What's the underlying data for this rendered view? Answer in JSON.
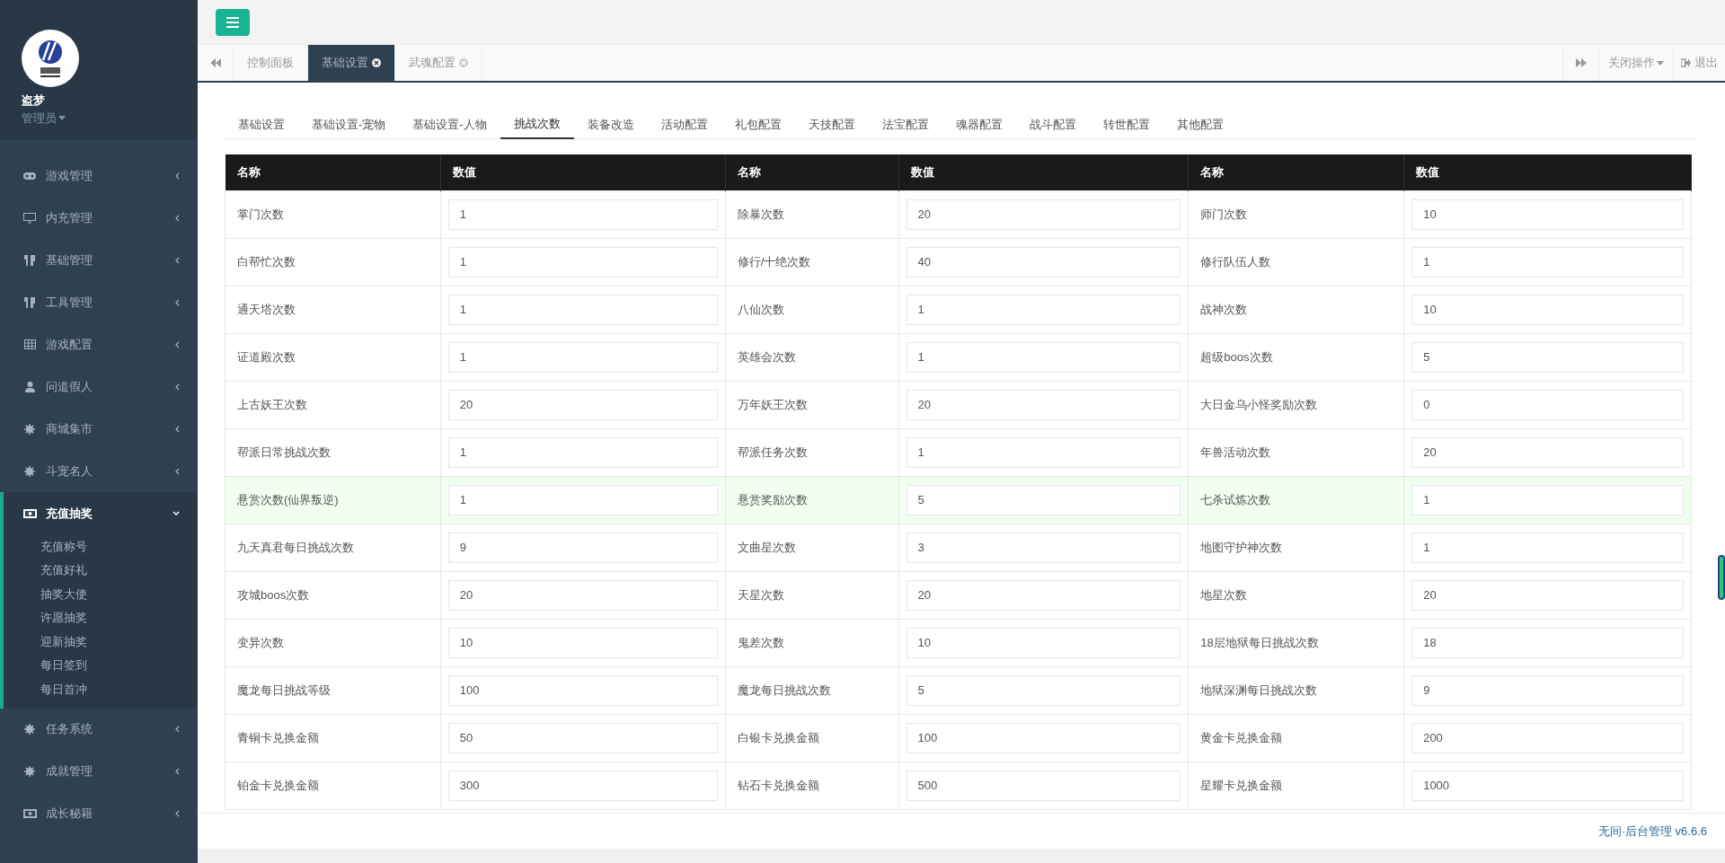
{
  "sidebar": {
    "user": {
      "name": "盗梦",
      "role": "管理员"
    },
    "items": [
      {
        "label": "游戏管理",
        "expanded": false
      },
      {
        "label": "内充管理",
        "expanded": false
      },
      {
        "label": "基础管理",
        "expanded": false
      },
      {
        "label": "工具管理",
        "expanded": false
      },
      {
        "label": "游戏配置",
        "expanded": false
      },
      {
        "label": "问道假人",
        "expanded": false
      },
      {
        "label": "商城集市",
        "expanded": false
      },
      {
        "label": "斗宠名人",
        "expanded": false
      },
      {
        "label": "充值抽奖",
        "expanded": true,
        "children": [
          {
            "label": "充值称号"
          },
          {
            "label": "充值好礼"
          },
          {
            "label": "抽奖大使"
          },
          {
            "label": "许愿抽奖"
          },
          {
            "label": "迎新抽奖"
          },
          {
            "label": "每日签到"
          },
          {
            "label": "每日首冲"
          }
        ]
      },
      {
        "label": "任务系统",
        "expanded": false
      },
      {
        "label": "成就管理",
        "expanded": false
      },
      {
        "label": "成长秘籍",
        "expanded": false
      }
    ]
  },
  "page_tabs": [
    {
      "label": "控制面板",
      "selected": false,
      "closable": false
    },
    {
      "label": "基础设置",
      "selected": true,
      "closable": true
    },
    {
      "label": "武魂配置",
      "selected": false,
      "closable": true
    }
  ],
  "tab_actions": {
    "close_menu": "关闭操作",
    "logout": "退出"
  },
  "sub_tabs": [
    {
      "label": "基础设置",
      "selected": false
    },
    {
      "label": "基础设置-宠物",
      "selected": false
    },
    {
      "label": "基础设置-人物",
      "selected": false
    },
    {
      "label": "挑战次数",
      "selected": true
    },
    {
      "label": "装备改造",
      "selected": false
    },
    {
      "label": "活动配置",
      "selected": false
    },
    {
      "label": "礼包配置",
      "selected": false
    },
    {
      "label": "天技配置",
      "selected": false
    },
    {
      "label": "法宝配置",
      "selected": false
    },
    {
      "label": "魂器配置",
      "selected": false
    },
    {
      "label": "战斗配置",
      "selected": false
    },
    {
      "label": "转世配置",
      "selected": false
    },
    {
      "label": "其他配置",
      "selected": false
    }
  ],
  "table": {
    "columns": [
      "名称",
      "数值",
      "名称",
      "数值",
      "名称",
      "数值"
    ],
    "rows": [
      {
        "highlighted": false,
        "cells": [
          "掌门次数",
          "1",
          "除暴次数",
          "20",
          "师门次数",
          "10"
        ]
      },
      {
        "highlighted": false,
        "cells": [
          "白帮忙次数",
          "1",
          "修行/十绝次数",
          "40",
          "修行队伍人数",
          "1"
        ]
      },
      {
        "highlighted": false,
        "cells": [
          "通天塔次数",
          "1",
          "八仙次数",
          "1",
          "战神次数",
          "10"
        ]
      },
      {
        "highlighted": false,
        "cells": [
          "证道殿次数",
          "1",
          "英雄会次数",
          "1",
          "超级boos次数",
          "5"
        ]
      },
      {
        "highlighted": false,
        "cells": [
          "上古妖王次数",
          "20",
          "万年妖王次数",
          "20",
          "大日金乌小怪奖励次数",
          "0"
        ]
      },
      {
        "highlighted": false,
        "cells": [
          "帮派日常挑战次数",
          "1",
          "帮派任务次数",
          "1",
          "年兽活动次数",
          "20"
        ]
      },
      {
        "highlighted": true,
        "cells": [
          "悬赏次数(仙界叛逆)",
          "1",
          "悬赏奖励次数",
          "5",
          "七杀试炼次数",
          "1"
        ]
      },
      {
        "highlighted": false,
        "cells": [
          "九天真君每日挑战次数",
          "9",
          "文曲星次数",
          "3",
          "地图守护神次数",
          "1"
        ]
      },
      {
        "highlighted": false,
        "cells": [
          "攻城boos次数",
          "20",
          "天星次数",
          "20",
          "地星次数",
          "20"
        ]
      },
      {
        "highlighted": false,
        "cells": [
          "变异次数",
          "10",
          "鬼差次数",
          "10",
          "18层地狱每日挑战次数",
          "18"
        ]
      },
      {
        "highlighted": false,
        "cells": [
          "魔龙每日挑战等级",
          "100",
          "魔龙每日挑战次数",
          "5",
          "地狱深渊每日挑战次数",
          "9"
        ]
      },
      {
        "highlighted": false,
        "cells": [
          "青铜卡兑换金额",
          "50",
          "白银卡兑换金额",
          "100",
          "黄金卡兑换金额",
          "200"
        ]
      },
      {
        "highlighted": false,
        "cells": [
          "铂金卡兑换金额",
          "300",
          "钻石卡兑换金额",
          "500",
          "星耀卡兑换金额",
          "1000"
        ]
      }
    ]
  },
  "footer": "无间·后台管理 v6.6.6"
}
